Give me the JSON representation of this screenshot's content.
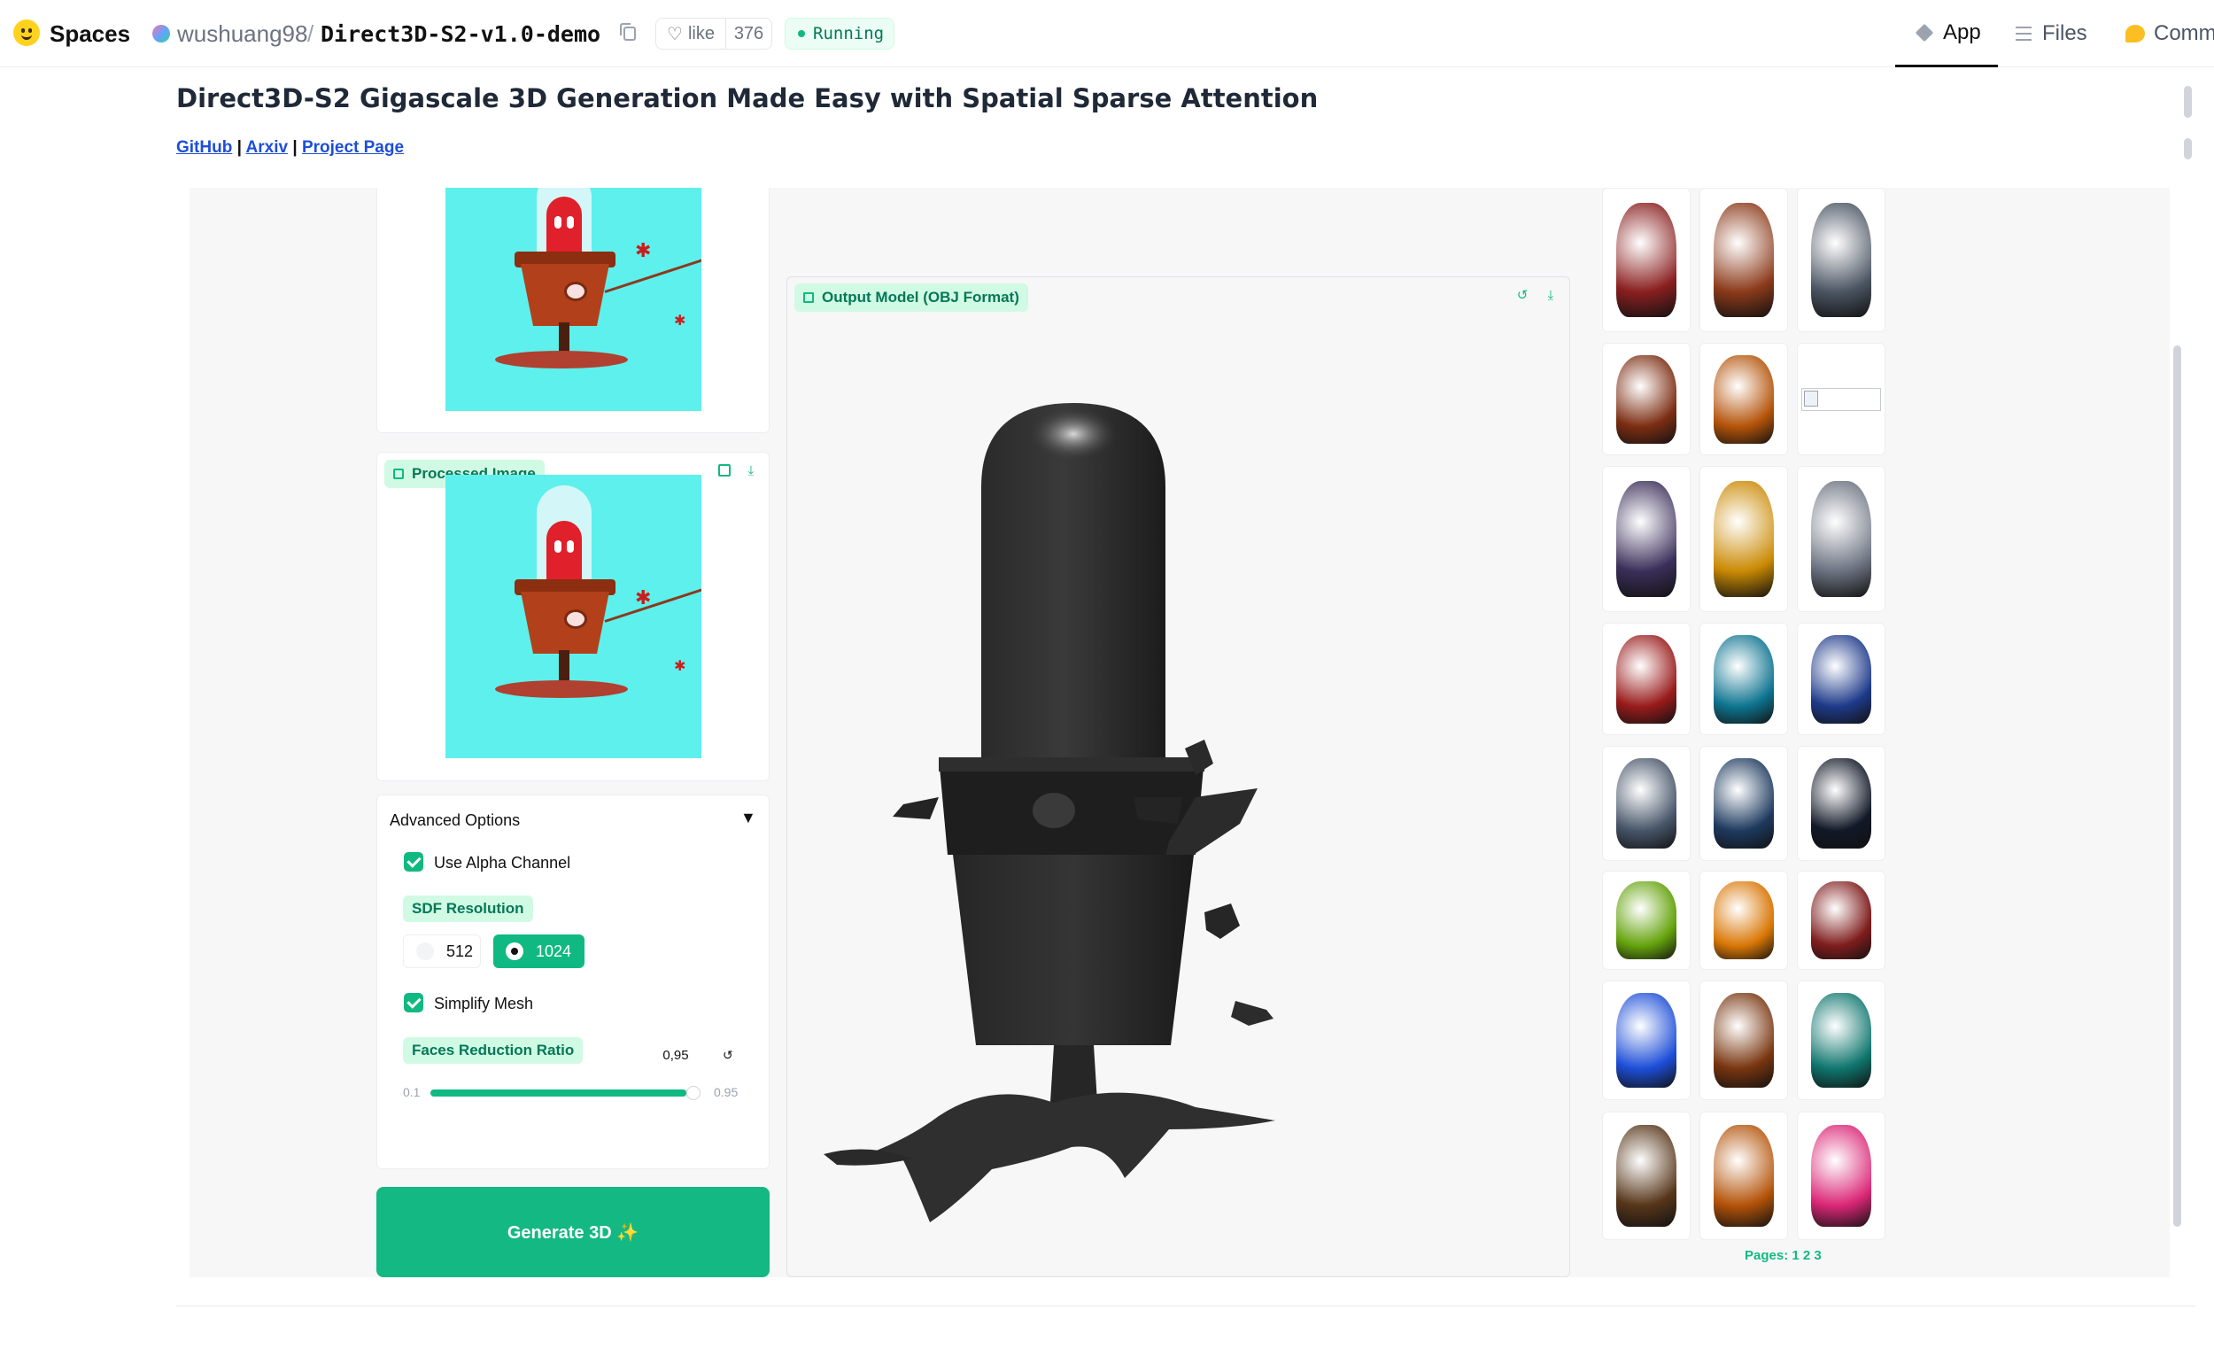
{
  "topbar": {
    "spaces_label": "Spaces",
    "owner": "wushuang98",
    "separator": "/",
    "repo": "Direct3D-S2-v1.0-demo",
    "like_label": "like",
    "like_count": "376",
    "status": "Running",
    "tabs": [
      {
        "label": "App",
        "icon": "cube-icon",
        "active": true
      },
      {
        "label": "Files",
        "icon": "files-icon",
        "active": false
      },
      {
        "label": "Comm",
        "icon": "community-icon",
        "active": false
      }
    ]
  },
  "header": {
    "title": "Direct3D-S2 Gigascale 3D Generation Made Easy with Spatial Sparse Attention",
    "links": [
      {
        "label": "GitHub"
      },
      {
        "label": "Arxiv"
      },
      {
        "label": "Project Page"
      }
    ],
    "link_sep": "|"
  },
  "left": {
    "processed_label": "Processed Image",
    "advanced": {
      "title": "Advanced Options",
      "caret": "▼",
      "use_alpha_label": "Use Alpha Channel",
      "use_alpha_checked": true,
      "sdf_label": "SDF Resolution",
      "sdf_options": [
        "512",
        "1024"
      ],
      "sdf_selected": "1024",
      "simplify_label": "Simplify Mesh",
      "simplify_checked": true,
      "faces_label": "Faces Reduction Ratio",
      "faces_value": "0,95",
      "reset_icon": "↺",
      "slider_min": "0.1",
      "slider_max": "0.95",
      "slider_value": 0.95
    },
    "generate_label": "Generate 3D ✨"
  },
  "output": {
    "label": "Output Model (OBJ Format)"
  },
  "gallery": {
    "pages_label": "Pages:",
    "pages": [
      "1",
      "2",
      "3"
    ],
    "colors": {
      "accent": "#10b981",
      "robot": "#8a1f1f",
      "spider": "#8b3a1a",
      "car": "#4b5563",
      "demon": "#7c2d12",
      "gun": "#b45309",
      "house": "#3b2f5a",
      "mech": "#ca8a04",
      "owl": "#6b7280",
      "redcar": "#991b1b",
      "dragon": "#0e7490",
      "dragon2": "#1e3a8a",
      "golem": "#475569",
      "robo2": "#1e3a5f",
      "armor": "#111827",
      "computer": "#65a30d",
      "excavator": "#d97706",
      "eagle": "#7f1d1d",
      "bike": "#1d4ed8",
      "cabin": "#78350f",
      "bot3": "#0f766e",
      "cart": "#57361a",
      "beast": "#b45309",
      "pinkdragon": "#db2777"
    }
  }
}
